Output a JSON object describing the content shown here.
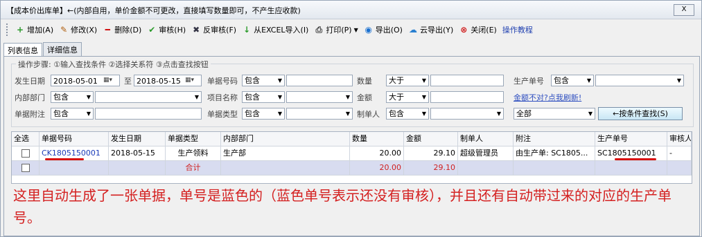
{
  "window": {
    "title": "【成本价出库单】←(内部自用，单价金额不可更改，直接填写数量即可，不产生应收款)",
    "close": "X"
  },
  "toolbar": [
    {
      "label": "增加(A)",
      "icon": "add-icon"
    },
    {
      "label": "修改(X)",
      "icon": "edit-icon"
    },
    {
      "label": "删除(D)",
      "icon": "delete-icon"
    },
    {
      "label": "审核(H)",
      "icon": "check-icon"
    },
    {
      "label": "反审核(F)",
      "icon": "unapprove-icon"
    },
    {
      "label": "从EXCEL导入(I)",
      "icon": "import-icon"
    },
    {
      "label": "打印(P)",
      "icon": "print-icon"
    },
    {
      "label": "导出(O)",
      "icon": "export-icon"
    },
    {
      "label": "云导出(Y)",
      "icon": "cloud-export-icon"
    },
    {
      "label": "关闭(E)",
      "icon": "close-circle-icon"
    },
    {
      "label": "操作教程",
      "icon": ""
    }
  ],
  "tabs": [
    "列表信息",
    "详细信息"
  ],
  "filter": {
    "legend": "操作步骤: ①输入查找条件 ②选择关系符 ③点击查找按钮",
    "date_label": "发生日期",
    "date_from": "2018-05-01",
    "to": "至",
    "date_to": "2018-05-15",
    "billno_label": "单据号码",
    "contains": "包含",
    "qty_label": "数量",
    "greater": "大于",
    "prodno_label": "生产单号",
    "dept_label": "内部部门",
    "project_label": "项目名称",
    "amount_label": "金额",
    "hint_link": "金额不对?点我刷新!",
    "note_label": "单据附注",
    "type_label": "单据类型",
    "maker_label": "制单人",
    "all": "全部",
    "search_btn": "←按条件查找(S)"
  },
  "table": {
    "headers": [
      "全选",
      "单据号码",
      "发生日期",
      "单据类型",
      "内部部门",
      "数量",
      "金额",
      "制单人",
      "附注",
      "生产单号",
      "审核人"
    ],
    "rows": [
      [
        "",
        "CK1805150001",
        "2018-05-15",
        "生产领料",
        "生产部",
        "20.00",
        "29.10",
        "超级管理员",
        "由生产单: SC1805...",
        "SC1805150001",
        "-"
      ]
    ],
    "total": {
      "label": "合计",
      "qty": "20.00",
      "amount": "29.10"
    }
  },
  "annotation": "这里自动生成了一张单据，单号是蓝色的（蓝色单号表示还没有审核），并且还有自动带过来的对应的生产单号。",
  "colors": {
    "red": "#d02020",
    "blue": "#1a3ab8"
  }
}
